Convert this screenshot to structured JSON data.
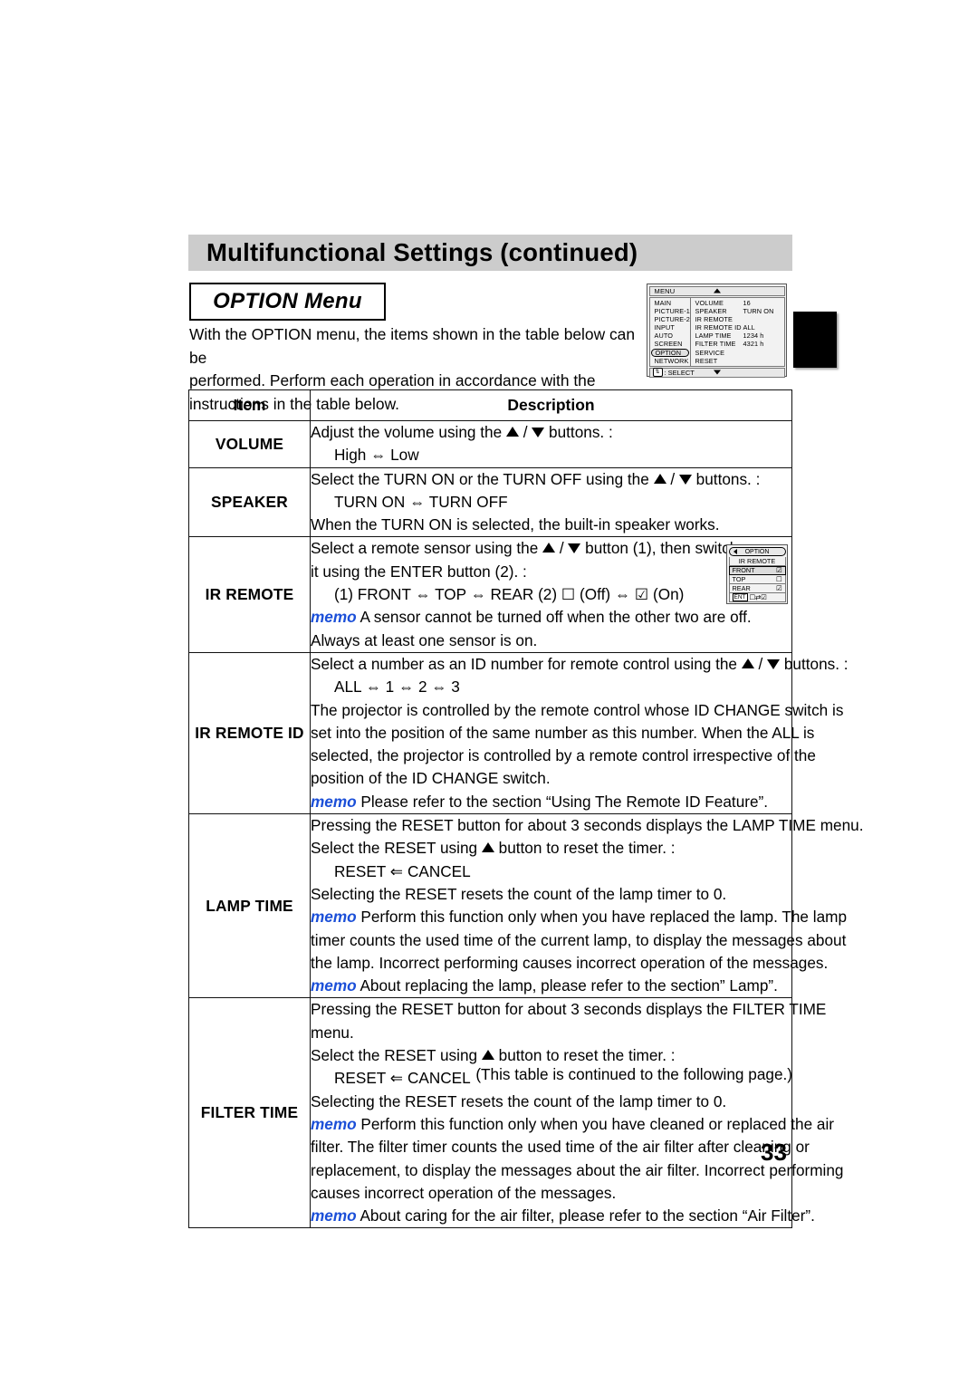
{
  "page": {
    "header_title": "Multifunctional Settings (continued)",
    "section_title": "OPTION Menu",
    "intro_line1": "With the  OPTION menu, the items shown in the table below can be",
    "intro_line2": "performed. Perform each operation in accordance with the",
    "intro_line3": "instructions in the table below.",
    "continued_note": "(This table is continued to the following page.)",
    "page_number": "33",
    "header_bg": "#cccccc",
    "memo_color": "#1b4fd8"
  },
  "osd_main": {
    "titlebar_label": "MENU",
    "up_arrow": "▲",
    "down_arrow": "▼",
    "left_items": [
      "MAIN",
      "PICTURE-1",
      "PICTURE-2",
      "INPUT",
      "AUTO",
      "SCREEN",
      "OPTION",
      "NETWORK"
    ],
    "selected_left_item": "OPTION",
    "right_rows": [
      {
        "key": "VOLUME",
        "value": "16"
      },
      {
        "key": "SPEAKER",
        "value": "TURN ON"
      },
      {
        "key": "IR REMOTE",
        "value": ""
      },
      {
        "key": "IR REMOTE ID",
        "value": "ALL"
      },
      {
        "key": "LAMP TIME",
        "value": "1234 h"
      },
      {
        "key": "FILTER TIME",
        "value": "4321 h"
      },
      {
        "key": "SERVICE",
        "value": ""
      },
      {
        "key": "RESET",
        "value": ""
      }
    ],
    "footer_icon": "⇅",
    "footer_label": ": SELECT"
  },
  "osd_ir_remote": {
    "top_label": "OPTION",
    "back_arrow": "◀",
    "title": "IR REMOTE",
    "rows": [
      {
        "label": "FRONT",
        "mark": "☑",
        "selected": true
      },
      {
        "label": "TOP",
        "mark": "☐",
        "selected": false
      },
      {
        "label": "REAR",
        "mark": "☑",
        "selected": false
      }
    ],
    "ent_label": "ENT",
    "ent_marks": "☐⇄☑"
  },
  "table": {
    "headers": {
      "item": "Item",
      "description": "Description"
    },
    "rows": [
      {
        "item": "VOLUME",
        "lines": [
          {
            "text_before": "Adjust the volume using the ",
            "tri_up": true,
            "text_mid": " / ",
            "tri_down": true,
            "text_after": " buttons. :"
          },
          {
            "indent": true,
            "text": "High ⇔ Low"
          }
        ]
      },
      {
        "item": "SPEAKER",
        "lines": [
          {
            "text_before": "Select the TURN ON or the TURN OFF using the ",
            "tri_up": true,
            "text_mid": " / ",
            "tri_down": true,
            "text_after": " buttons. :"
          },
          {
            "indent": true,
            "text": "TURN ON ⇔ TURN OFF"
          },
          {
            "text": "When the TURN ON is selected, the built-in speaker works."
          }
        ]
      },
      {
        "item": "IR REMOTE",
        "lines": [
          {
            "text_before": "Select a remote sensor using the ",
            "tri_up": true,
            "text_mid": " / ",
            "tri_down": true,
            "text_after": " button (1), then switch"
          },
          {
            "text": "it using the ENTER button (2). :"
          },
          {
            "indent": true,
            "text": "(1) FRONT ⇔ TOP ⇔ REAR   (2) ☐ (Off)  ⇔ ☑ (On)"
          },
          {
            "memo": "memo",
            "text": " A sensor cannot be turned off when the other two are off."
          },
          {
            "text": "Always at least one sensor is on."
          }
        ]
      },
      {
        "item": "IR REMOTE ID",
        "lines": [
          {
            "text_before": "Select a number as an ID number for remote control using the ",
            "tri_up": true,
            "text_mid": " / ",
            "tri_down": true,
            "text_after": " buttons. :"
          },
          {
            "indent": true,
            "text": "ALL ⇔ 1 ⇔ 2 ⇔ 3"
          },
          {
            "text": "The projector is controlled by the remote control whose ID CHANGE switch is"
          },
          {
            "text": "set into the position of the same number as this number. When the ALL is"
          },
          {
            "text": "selected, the projector is controlled by a remote control irrespective of the"
          },
          {
            "text": "position of the ID CHANGE switch."
          },
          {
            "memo": "memo",
            "text": " Please refer to the section “Using The Remote ID Feature”."
          }
        ]
      },
      {
        "item": "LAMP TIME",
        "lines": [
          {
            "text": "Pressing the RESET button for about 3 seconds displays the LAMP TIME menu."
          },
          {
            "text_before": "Select the RESET using ",
            "tri_up": true,
            "text_after": " button to reset the timer. :"
          },
          {
            "indent": true,
            "text": "RESET ⇐ CANCEL"
          },
          {
            "text": "Selecting the RESET resets the count of the lamp timer to 0."
          },
          {
            "memo": "memo",
            "text": " Perform this function only when you have replaced the lamp. The lamp"
          },
          {
            "text": "timer counts the used time of the current lamp, to display the messages about"
          },
          {
            "text": "the lamp. Incorrect performing causes incorrect operation of the messages."
          },
          {
            "memo": "memo",
            "text": " About replacing the lamp, please refer to the section” Lamp”."
          }
        ]
      },
      {
        "item": "FILTER TIME",
        "lines": [
          {
            "text": "Pressing the RESET button for about 3 seconds displays the FILTER TIME"
          },
          {
            "text": "menu."
          },
          {
            "text_before": "Select the RESET using ",
            "tri_up": true,
            "text_after": " button to reset the timer. :"
          },
          {
            "indent": true,
            "text": "RESET ⇐ CANCEL"
          },
          {
            "text": "Selecting the RESET resets the count of the lamp timer to 0."
          },
          {
            "memo": "memo",
            "text": " Perform this function only when you have cleaned or replaced the air"
          },
          {
            "text": "filter. The filter timer counts the used time of the air filter after cleaning or"
          },
          {
            "text": "replacement, to display the messages about the air filter. Incorrect performing"
          },
          {
            "text": "causes incorrect operation of the messages."
          },
          {
            "memo": "memo",
            "text": " About caring for the air filter, please refer to the section “Air Filter”."
          }
        ]
      }
    ]
  }
}
